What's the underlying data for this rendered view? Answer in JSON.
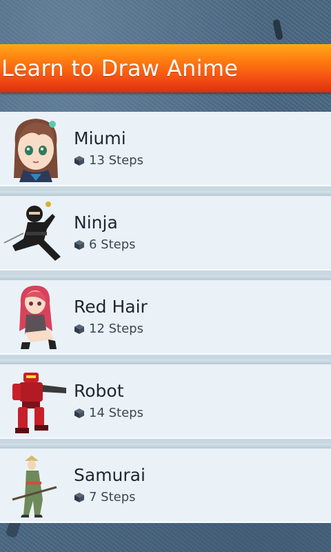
{
  "header": {
    "title": "Learn to Draw Anime"
  },
  "tutorials": [
    {
      "name": "Miumi",
      "steps": "13 Steps",
      "thumb_icon": "anime-girl-portrait"
    },
    {
      "name": "Ninja",
      "steps": "6 Steps",
      "thumb_icon": "ninja-figure"
    },
    {
      "name": "Red Hair",
      "steps": "12 Steps",
      "thumb_icon": "red-hair-girl"
    },
    {
      "name": "Robot",
      "steps": "14 Steps",
      "thumb_icon": "red-robot"
    },
    {
      "name": "Samurai",
      "steps": "7 Steps",
      "thumb_icon": "samurai-figure"
    }
  ],
  "colors": {
    "header_top": "#ffa81a",
    "header_bottom": "#d6320f",
    "list_bg": "#eaf2f8"
  }
}
